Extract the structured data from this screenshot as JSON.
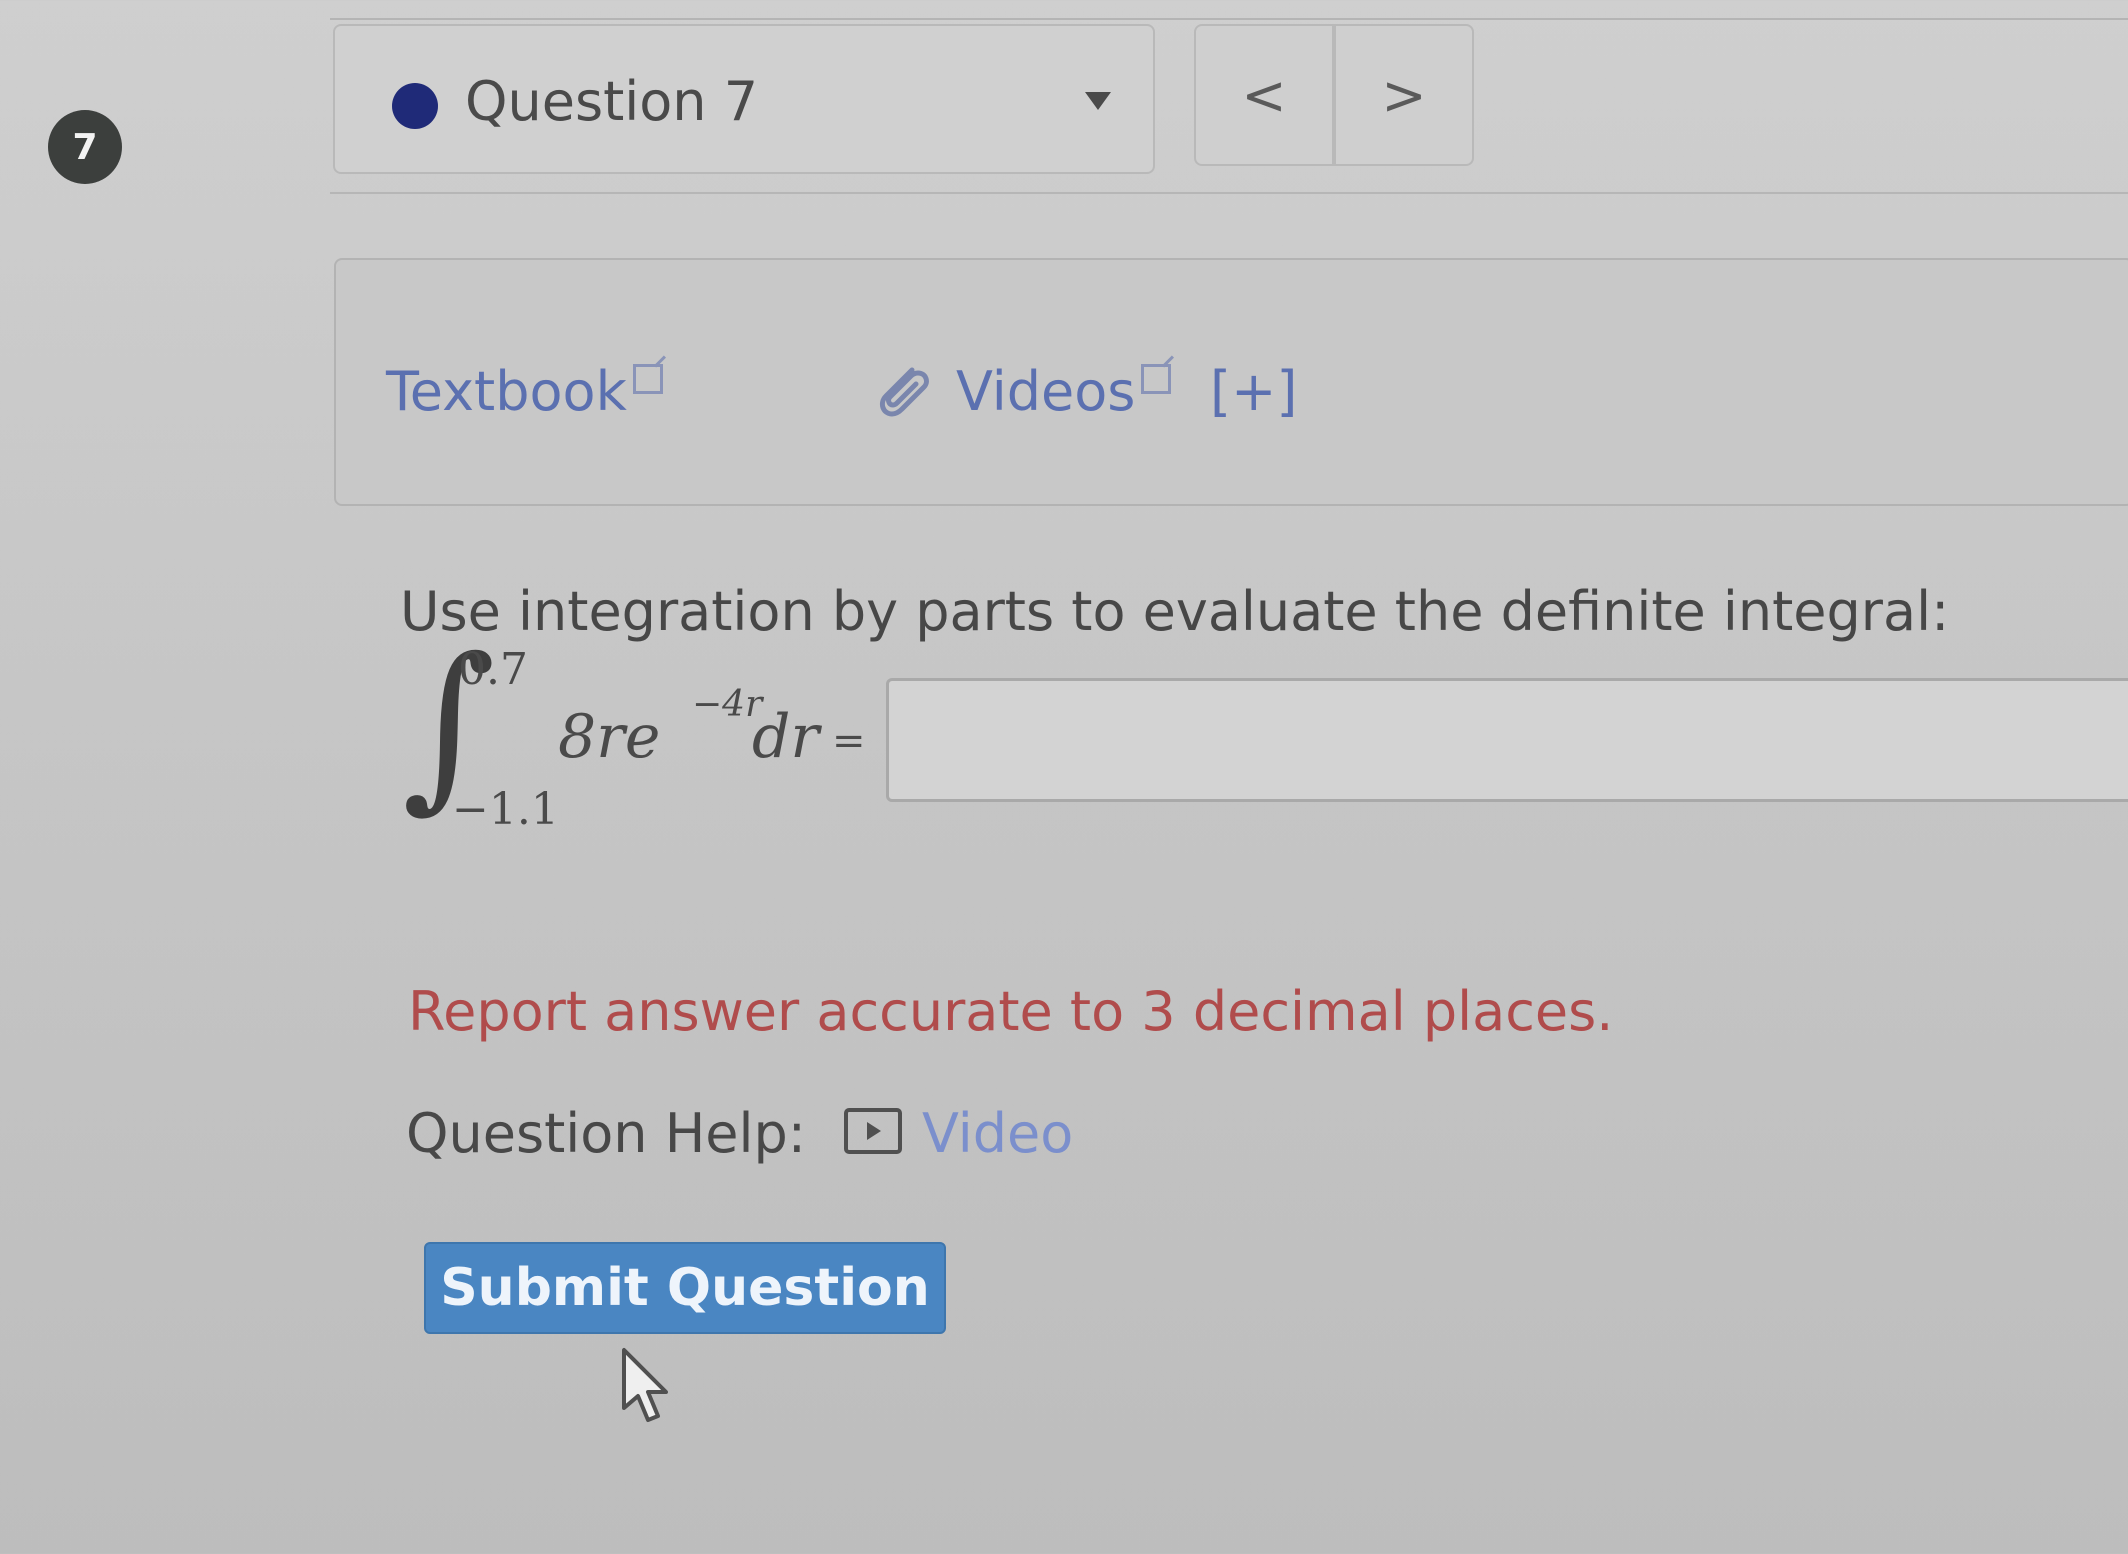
{
  "question_number": "7",
  "question_selector": {
    "label": "Question 7",
    "status_color": "#1f2a78"
  },
  "navigation": {
    "prev_label": "<",
    "next_label": ">"
  },
  "resources": {
    "textbook_label": "Textbook",
    "videos_label": "Videos",
    "expand_label": "[+]"
  },
  "problem": {
    "prompt": "Use integration by parts to evaluate the definite integral:",
    "integral": {
      "upper_limit": "0.7",
      "lower_limit": "−1.1",
      "integrand": "8re",
      "exponent": "−4r",
      "differential": "dr",
      "equals": "="
    },
    "answer_value": "",
    "note": "Report answer accurate to 3 decimal places."
  },
  "help": {
    "label": "Question Help:",
    "video_label": "Video"
  },
  "submit_label": "Submit Question",
  "colors": {
    "link": "#5b70b0",
    "note": "#b04c4c",
    "submit_bg": "#4a86c2"
  }
}
